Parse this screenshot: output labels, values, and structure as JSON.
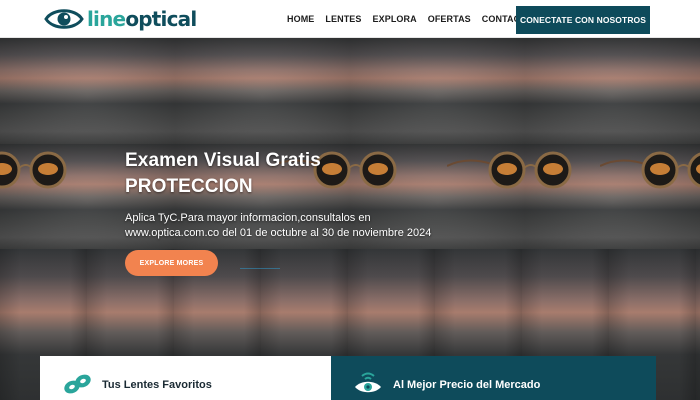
{
  "logo": {
    "text_light": "line",
    "text_dark": "optical"
  },
  "nav": {
    "items": [
      {
        "label": "HOME"
      },
      {
        "label": "LENTES"
      },
      {
        "label": "EXPLORA"
      },
      {
        "label": "OFERTAS"
      },
      {
        "label": "CONTACTO"
      }
    ],
    "cta_label": "CONECTATE CON NOSOTROS"
  },
  "hero": {
    "title_line1": "Examen Visual Gratis",
    "title_line2": "PROTECCION",
    "subtitle_line1": "Aplica TyC.Para mayor informacion,consultalos en",
    "subtitle_line2": "www.optica.com.co del 01 de octubre al 30 de noviembre 2024",
    "explore_label": "EXPLORE MORES"
  },
  "features": [
    {
      "title": "Tus Lentes Favoritos",
      "icon": "lens-icon"
    },
    {
      "title": "Al Mejor Precio del Mercado",
      "icon": "eye-signal-icon"
    }
  ],
  "colors": {
    "brand_dark": "#0e4b5b",
    "brand_light": "#2aa59b",
    "accent_orange": "#f2834f"
  }
}
